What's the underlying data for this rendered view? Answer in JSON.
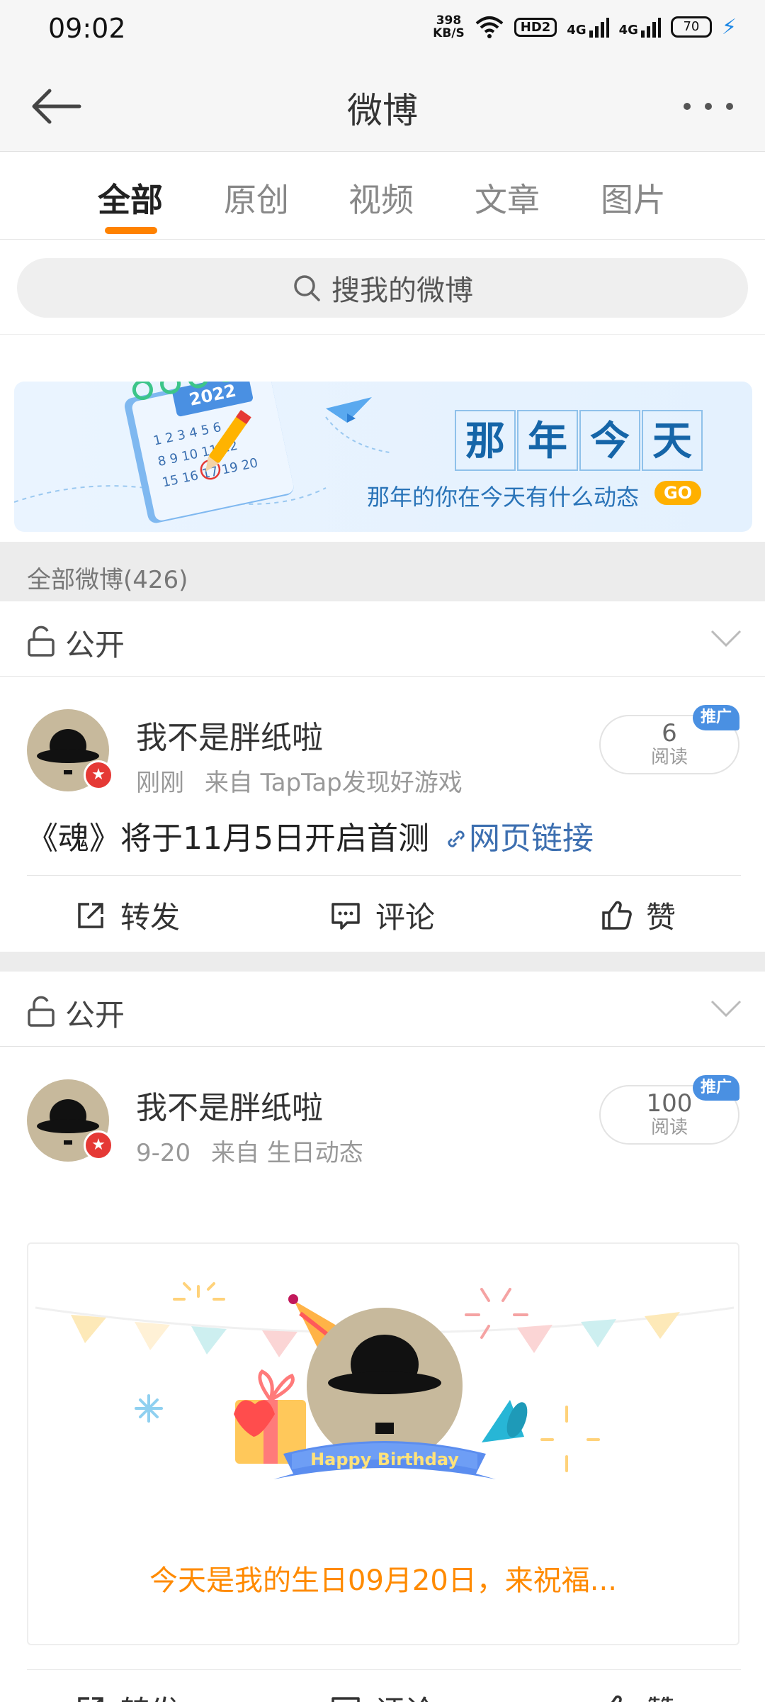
{
  "status_bar": {
    "time": "09:02",
    "net_speed_value": "398",
    "net_speed_unit": "KB/S",
    "hd_label": "HD2",
    "signal1_label": "4G",
    "signal2_label": "4G",
    "battery": "70"
  },
  "header": {
    "title": "微博"
  },
  "tabs": [
    {
      "label": "全部",
      "active": true
    },
    {
      "label": "原创",
      "active": false
    },
    {
      "label": "视频",
      "active": false
    },
    {
      "label": "文章",
      "active": false
    },
    {
      "label": "图片",
      "active": false
    }
  ],
  "search": {
    "placeholder": "搜我的微博"
  },
  "banner": {
    "title_chars": [
      "那",
      "年",
      "今",
      "天"
    ],
    "subtitle": "那年的你在今天有什么动态",
    "go_label": "GO",
    "calendar_year": "2022"
  },
  "section": {
    "count_label": "全部微博(426)"
  },
  "posts": [
    {
      "visibility": "公开",
      "username": "我不是胖纸啦",
      "time": "刚刚",
      "source": "来自 TapTap发现好游戏",
      "read_count": "6",
      "read_label": "阅读",
      "promo_tag": "推广",
      "text": "《魂》将于11月5日开启首测",
      "link_text": "网页链接",
      "actions": {
        "repost": "转发",
        "comment": "评论",
        "like": "赞"
      }
    },
    {
      "visibility": "公开",
      "username": "我不是胖纸啦",
      "time": "9-20",
      "source": "来自 生日动态",
      "read_count": "100",
      "read_label": "阅读",
      "promo_tag": "推广",
      "birthday_banner": "Happy Birthday",
      "birthday_text": "今天是我的生日09月20日，来祝福...",
      "actions": {
        "repost": "转发",
        "comment": "评论",
        "like": "赞"
      }
    }
  ],
  "colors": {
    "accent": "#ff8200",
    "link": "#3d6fb0",
    "promo": "#4a90e2"
  }
}
